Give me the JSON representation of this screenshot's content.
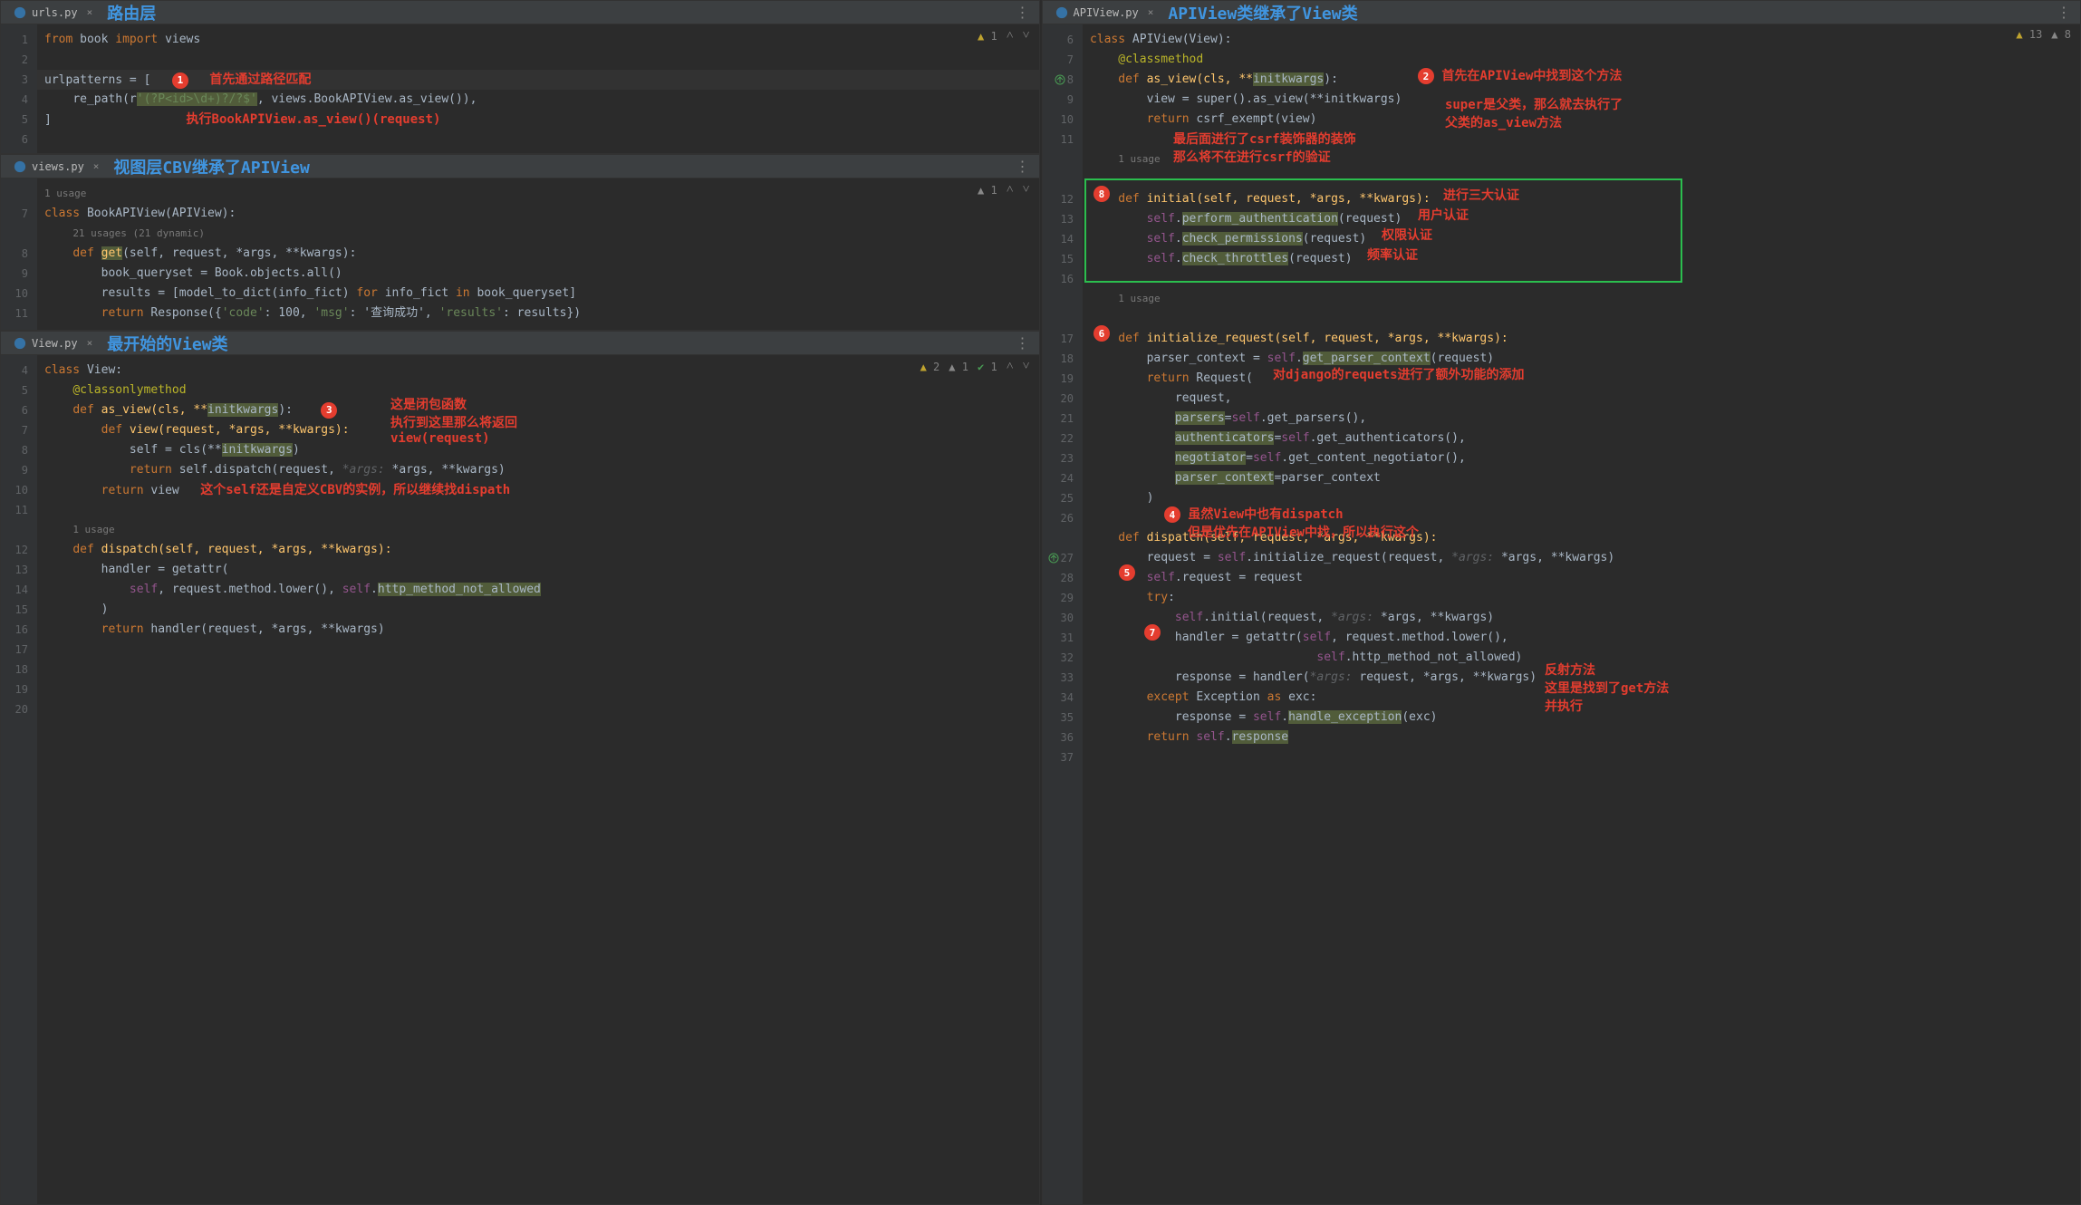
{
  "panes": {
    "urls": {
      "filename": "urls.py",
      "title": "路由层",
      "inspections": {
        "warn": 1
      },
      "lines": [
        1,
        2,
        3,
        4,
        5,
        6
      ],
      "code": {
        "l1_from": "from",
        "l1_book": "book",
        "l1_import": "import",
        "l1_views": "views",
        "l3_urlpatterns": "urlpatterns = [",
        "l4_repath": "re_path(r",
        "l4_regex": "'(?P<id>\\d+)?/?$'",
        "l4_views": ", views.BookAPIView.as_view()),",
        "l5_bracket": "]"
      },
      "annotations": {
        "a1_badge": "1",
        "a1_text": "首先通过路径匹配",
        "a1_sub": "执行BookAPIView.as_view()(request)"
      }
    },
    "views": {
      "filename": "views.py",
      "title": "视图层CBV继承了APIView",
      "inspections": {
        "weak": 1
      },
      "lines": [
        "",
        7,
        "",
        8,
        9,
        10,
        11
      ],
      "code": {
        "usage1": "1 usage",
        "l7_class": "class",
        "l7_name": "BookAPIView(APIView):",
        "usage21": "21 usages (21 dynamic)",
        "l8_def": "def",
        "l8_get": "get",
        "l8_params": "(self, request, *args, **kwargs):",
        "l9": "book_queryset = Book.objects.all()",
        "l10_a": "results = [model_to_dict(info_fict) ",
        "l10_for": "for",
        "l10_b": " info_fict ",
        "l10_in": "in",
        "l10_c": " book_queryset]",
        "l11_return": "return",
        "l11_resp": " Response({",
        "l11_code": "'code'",
        "l11_100": ": 100, ",
        "l11_msg": "'msg'",
        "l11_msgv": ": '查询成功', ",
        "l11_res": "'results'",
        "l11_resv": ": results})"
      }
    },
    "view": {
      "filename": "View.py",
      "title": "最开始的View类",
      "inspections": {
        "warn": 2,
        "weak": 1,
        "checks": 1
      },
      "lines": [
        4,
        5,
        6,
        7,
        8,
        9,
        10,
        11,
        "",
        12,
        13,
        14,
        15,
        16,
        17,
        18,
        19,
        20
      ],
      "code": {
        "l4_class": "class",
        "l4_view": " View:",
        "l5_dec": "@classonlymethod",
        "l6_def": "def",
        "l6_asview": " as_view(cls, **",
        "l6_init": "initkwargs",
        "l6_close": "):",
        "l7_def": "def",
        "l7_view": " view(request, *args, **kwargs):",
        "l8_self": "self = cls(**",
        "l8_init": "initkwargs",
        "l8_close": ")",
        "l9_return": "return",
        "l9_body": " self.dispatch(request, ",
        "l9_hint": "*args:",
        "l9_rest": " *args, **kwargs)",
        "l10_return": "return",
        "l10_view": " view",
        "usage1": "1 usage",
        "l12_def": "def",
        "l12_dispatch": " dispatch(self, request, *args, **kwargs):",
        "l13": "handler = getattr(",
        "l14_self": "self",
        "l14_mid": ", request.method.lower(), ",
        "l14_self2": "self",
        "l14_dot": ".",
        "l14_http": "http_method_not_allowed",
        "l15": ")",
        "l16_return": "return",
        "l16_body": " handler(request, *args, **kwargs)"
      },
      "annotations": {
        "a3_badge": "3",
        "a3_l1": "这是闭包函数",
        "a3_l2": "执行到这里那么将返回",
        "a3_l3": "view(request)",
        "a_self": "这个self还是自定义CBV的实例，所以继续找dispath"
      }
    },
    "apiview": {
      "filename": "APIView.py",
      "title": "APIView类继承了View类",
      "inspections": {
        "warn": 13,
        "weak": 8
      },
      "lines": [
        6,
        7,
        8,
        9,
        10,
        11,
        "",
        "",
        12,
        13,
        14,
        15,
        16,
        "",
        "",
        17,
        18,
        19,
        20,
        21,
        22,
        23,
        24,
        25,
        26,
        "",
        27,
        28,
        29,
        30,
        31,
        32,
        33,
        34,
        35,
        36,
        37
      ],
      "code": {
        "l6_class": "class",
        "l6_apiview": " APIView(View):",
        "l7_dec": "@classmethod",
        "l8_def": "def",
        "l8_asview": " as_view(cls, **",
        "l8_init": "initkwargs",
        "l8_close": "):",
        "l9": "view = super().as_view(**initkwargs)",
        "l10_return": "return",
        "l10_body": " csrf_exempt(view)",
        "usage1a": "1 usage",
        "l12_def": "def",
        "l12_initial": " initial(self, request, *args, **kwargs):",
        "l13_self": "self",
        "l13_dot": ".",
        "l13_fn": "perform_authentication",
        "l13_arg": "(request)",
        "l14_self": "self",
        "l14_dot": ".",
        "l14_fn": "check_permissions",
        "l14_arg": "(request)",
        "l15_self": "self",
        "l15_dot": ".",
        "l15_fn": "check_throttles",
        "l15_arg": "(request)",
        "usage1b": "1 usage",
        "l17_def": "def",
        "l17_ir": " initialize_request(self, request, *args, **kwargs):",
        "l18_a": "parser_context = ",
        "l18_self": "self",
        "l18_dot": ".",
        "l18_fn": "get_parser_context",
        "l18_arg": "(request)",
        "l19_return": "return",
        "l19_req": " Request(",
        "l20": "request,",
        "l21_k": "parsers",
        "l21_eq": "=",
        "l21_self": "self",
        "l21_body": ".get_parsers(),",
        "l22_k": "authenticators",
        "l22_eq": "=",
        "l22_self": "self",
        "l22_body": ".get_authenticators(),",
        "l23_k": "negotiator",
        "l23_eq": "=",
        "l23_self": "self",
        "l23_body": ".get_content_negotiator(),",
        "l24_k": "parser_context",
        "l24_eq": "=parser_context",
        "l25": ")",
        "l27_def": "def",
        "l27_dispatch": " dispatch(self, request, *args, **kwargs):",
        "l28_a": "request = ",
        "l28_self": "self",
        "l28_b": ".initialize_request(request, ",
        "l28_hint": "*args:",
        "l28_c": " *args, **kwargs)",
        "l29_self": "self",
        "l29_body": ".request = request",
        "l30_try": "try",
        "l30_colon": ":",
        "l31_self": "self",
        "l31_body": ".initial(request, ",
        "l31_hint": "*args:",
        "l31_c": " *args, **kwargs)",
        "l32_a": "handler = getattr(",
        "l32_self": "self",
        "l32_b": ", request.method.lower(),",
        "l33_self": "self",
        "l33_body": ".http_method_not_allowed)",
        "l34_a": "response = handler(",
        "l34_hint": "*args:",
        "l34_b": " request, *args, **kwargs)",
        "l35_except": "except",
        "l35_body": " Exception ",
        "l35_as": "as",
        "l35_exc": " exc:",
        "l36_a": "response = ",
        "l36_self": "self",
        "l36_dot": ".",
        "l36_fn": "handle_exception",
        "l36_arg": "(exc)",
        "l37_return": "return",
        "l37_self": " self",
        "l37_dot": ".",
        "l37_resp": "response"
      },
      "annotations": {
        "a2_badge": "2",
        "a2_text": "首先在APIView中找到这个方法",
        "a2_sub1": "super是父类，那么就去执行了",
        "a2_sub2": "父类的as_view方法",
        "a_csrf1": "最后面进行了csrf装饰器的装饰",
        "a_csrf2": "那么将不在进行csrf的验证",
        "a8_badge": "8",
        "a8_text": "进行三大认证",
        "a8_l1": "用户认证",
        "a8_l2": "权限认证",
        "a8_l3": "频率认证",
        "a6_badge": "6",
        "a_django": "对django的requets进行了额外功能的添加",
        "a4_badge": "4",
        "a4_l1": "虽然View中也有dispatch",
        "a4_l2": "但是优先在APIView中找，所以执行这个",
        "a5_badge": "5",
        "a7_badge": "7",
        "a_reflect1": "反射方法",
        "a_reflect2": "这里是找到了get方法",
        "a_reflect3": "并执行"
      }
    }
  }
}
